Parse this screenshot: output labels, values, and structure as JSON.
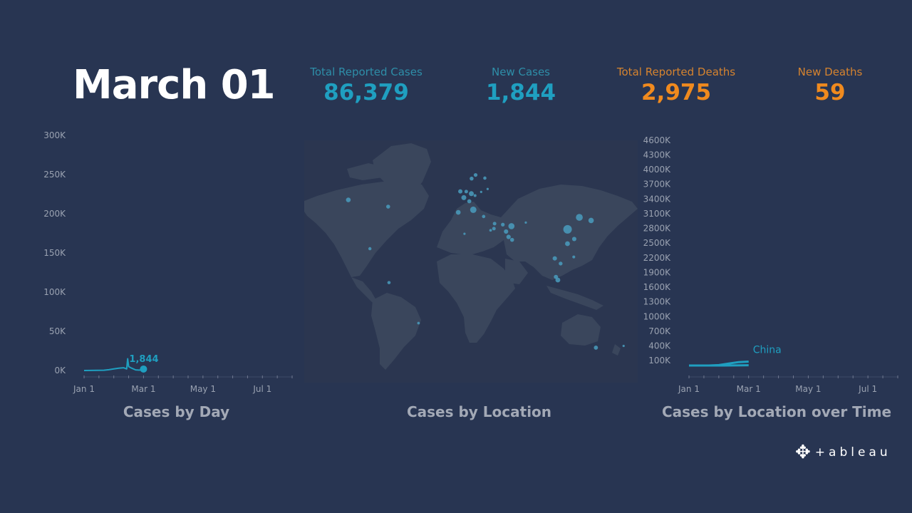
{
  "date": "March 01",
  "kpis": {
    "total_cases": {
      "label": "Total Reported Cases",
      "value": "86,379"
    },
    "new_cases": {
      "label": "New Cases",
      "value": "1,844"
    },
    "total_deaths": {
      "label": "Total Reported Deaths",
      "value": "2,975"
    },
    "new_deaths": {
      "label": "New Deaths",
      "value": "59"
    }
  },
  "colors": {
    "background": "#283552",
    "cases_accent": "#1f9fc0",
    "deaths_accent": "#f08a1e",
    "map_land": "#3a465c",
    "map_water": "#2b3650"
  },
  "brand": {
    "name": "+ableau",
    "icon": "tableau-logo-icon"
  },
  "chart_data": [
    {
      "type": "line",
      "id": "cases_by_day",
      "title": "Cases by Day",
      "xlabel": "",
      "ylabel": "",
      "x_ticks": [
        "Jan 1",
        "Mar 1",
        "May 1",
        "Jul 1"
      ],
      "y_ticks": [
        "0K",
        "50K",
        "100K",
        "150K",
        "200K",
        "250K",
        "300K"
      ],
      "ylim": [
        0,
        300000
      ],
      "x_days_range": [
        0,
        210
      ],
      "series": [
        {
          "name": "",
          "points": [
            {
              "day": 0,
              "value": 0
            },
            {
              "day": 20,
              "value": 300
            },
            {
              "day": 25,
              "value": 1000
            },
            {
              "day": 30,
              "value": 2000
            },
            {
              "day": 35,
              "value": 3000
            },
            {
              "day": 40,
              "value": 3500
            },
            {
              "day": 43,
              "value": 2000
            },
            {
              "day": 44,
              "value": 15000
            },
            {
              "day": 45,
              "value": 5000
            },
            {
              "day": 48,
              "value": 3000
            },
            {
              "day": 52,
              "value": 800
            },
            {
              "day": 56,
              "value": 500
            },
            {
              "day": 60,
              "value": 1844
            }
          ]
        }
      ],
      "annotation": {
        "text": "1,844",
        "day": 60,
        "value": 1844
      },
      "grid": false
    },
    {
      "type": "scatter",
      "id": "cases_by_location",
      "title": "Cases by Location",
      "points": [
        {
          "lon": 114.3,
          "lat": 30.6,
          "cases": 79968
        },
        {
          "lon": 127.0,
          "lat": 37.5,
          "cases": 3736
        },
        {
          "lon": 12.5,
          "lat": 41.9,
          "cases": 1694
        },
        {
          "lon": 53.7,
          "lat": 32.4,
          "cases": 978
        },
        {
          "lon": 139.7,
          "lat": 35.7,
          "cases": 256
        },
        {
          "lon": 2.3,
          "lat": 48.9,
          "cases": 130
        },
        {
          "lon": 10.4,
          "lat": 51.2,
          "cases": 129
        },
        {
          "lon": -3.7,
          "lat": 40.4,
          "cases": 84
        },
        {
          "lon": 103.8,
          "lat": 1.3,
          "cases": 106
        },
        {
          "lon": -122.4,
          "lat": 47.6,
          "cases": 76
        },
        {
          "lon": 101.7,
          "lat": 3.1,
          "cases": 29
        },
        {
          "lon": 8.2,
          "lat": 46.8,
          "cases": 27
        },
        {
          "lon": -1.5,
          "lat": 52.5,
          "cases": 36
        },
        {
          "lon": 4.9,
          "lat": 52.4,
          "cases": 10
        },
        {
          "lon": 15.0,
          "lat": 62.0,
          "cases": 14
        },
        {
          "lon": 10.7,
          "lat": 59.9,
          "cases": 19
        },
        {
          "lon": 25.0,
          "lat": 60.2,
          "cases": 6
        },
        {
          "lon": 50.6,
          "lat": 26.2,
          "cases": 47
        },
        {
          "lon": 47.9,
          "lat": 29.3,
          "cases": 45
        },
        {
          "lon": 54.4,
          "lat": 24.5,
          "cases": 21
        },
        {
          "lon": 44.4,
          "lat": 33.3,
          "cases": 13
        },
        {
          "lon": 35.5,
          "lat": 33.9,
          "cases": 10
        },
        {
          "lon": 34.8,
          "lat": 31.0,
          "cases": 10
        },
        {
          "lon": 31.2,
          "lat": 30.0,
          "cases": 2
        },
        {
          "lon": 3.0,
          "lat": 28.0,
          "cases": 1
        },
        {
          "lon": 69.2,
          "lat": 34.5,
          "cases": 1
        },
        {
          "lon": 121.0,
          "lat": 14.6,
          "cases": 3
        },
        {
          "lon": 100.5,
          "lat": 13.8,
          "cases": 42
        },
        {
          "lon": 106.8,
          "lat": 10.8,
          "cases": 16
        },
        {
          "lon": 114.2,
          "lat": 22.3,
          "cases": 100
        },
        {
          "lon": 121.5,
          "lat": 25.0,
          "cases": 40
        },
        {
          "lon": 144.9,
          "lat": -37.8,
          "cases": 27
        },
        {
          "lon": -79.4,
          "lat": 43.7,
          "cases": 20
        },
        {
          "lon": -99.1,
          "lat": 19.4,
          "cases": 5
        },
        {
          "lon": -78.5,
          "lat": -0.2,
          "cases": 6
        },
        {
          "lon": -46.6,
          "lat": -23.6,
          "cases": 2
        },
        {
          "lon": 174.8,
          "lat": -36.8,
          "cases": 1
        },
        {
          "lon": 21.0,
          "lat": 52.2,
          "cases": 1
        },
        {
          "lon": 14.4,
          "lat": 50.1,
          "cases": 3
        },
        {
          "lon": 23.7,
          "lat": 38.0,
          "cases": 7
        },
        {
          "lon": 28.0,
          "lat": 53.9,
          "cases": 1
        }
      ]
    },
    {
      "type": "line",
      "id": "cases_by_location_over_time",
      "title": "Cases by Location over Time",
      "x_ticks": [
        "Jan 1",
        "Mar 1",
        "May 1",
        "Jul 1"
      ],
      "y_ticks": [
        "100K",
        "400K",
        "700K",
        "1000K",
        "1300K",
        "1600K",
        "1900K",
        "2200K",
        "2500K",
        "2800K",
        "3100K",
        "3400K",
        "3700K",
        "4000K",
        "4300K",
        "4600K"
      ],
      "ylim": [
        0,
        4700000
      ],
      "x_days_range": [
        0,
        210
      ],
      "series": [
        {
          "name": "China",
          "points": [
            {
              "day": 0,
              "value": 0
            },
            {
              "day": 20,
              "value": 500
            },
            {
              "day": 30,
              "value": 10000
            },
            {
              "day": 40,
              "value": 40000
            },
            {
              "day": 50,
              "value": 70000
            },
            {
              "day": 60,
              "value": 80000
            }
          ]
        },
        {
          "name": "",
          "points": [
            {
              "day": 0,
              "value": 0
            },
            {
              "day": 30,
              "value": 0
            },
            {
              "day": 45,
              "value": 2000
            },
            {
              "day": 60,
              "value": 6000
            }
          ]
        }
      ],
      "grid": false
    }
  ]
}
